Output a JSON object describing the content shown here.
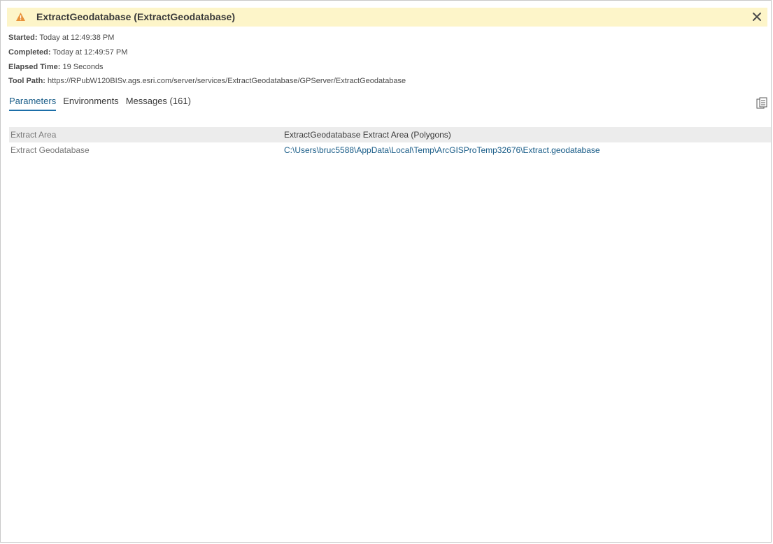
{
  "banner": {
    "title": "ExtractGeodatabase (ExtractGeodatabase)",
    "status_icon": "warning-triangle-icon",
    "close_icon": "close-icon",
    "colors": {
      "background": "#fdf5c9",
      "icon": "#e8923a"
    }
  },
  "meta": {
    "started_label": "Started:",
    "started_value": "Today at 12:49:38 PM",
    "completed_label": "Completed:",
    "completed_value": "Today at 12:49:57 PM",
    "elapsed_label": "Elapsed Time:",
    "elapsed_value": "19 Seconds",
    "toolpath_label": "Tool Path:",
    "toolpath_value": "https://RPubW120BISv.ags.esri.com/server/services/ExtractGeodatabase/GPServer/ExtractGeodatabase"
  },
  "tabs": [
    {
      "label": "Parameters",
      "active": true
    },
    {
      "label": "Environments",
      "active": false
    },
    {
      "label": "Messages (161)",
      "active": false
    }
  ],
  "toolbar": {
    "copy_icon": "copy-icon"
  },
  "parameters": [
    {
      "name": "Extract Area",
      "value": "ExtractGeodatabase Extract Area (Polygons)"
    },
    {
      "name": "Extract Geodatabase",
      "value": "C:\\Users\\bruc5588\\AppData\\Local\\Temp\\ArcGISProTemp32676\\Extract.geodatabase"
    }
  ]
}
